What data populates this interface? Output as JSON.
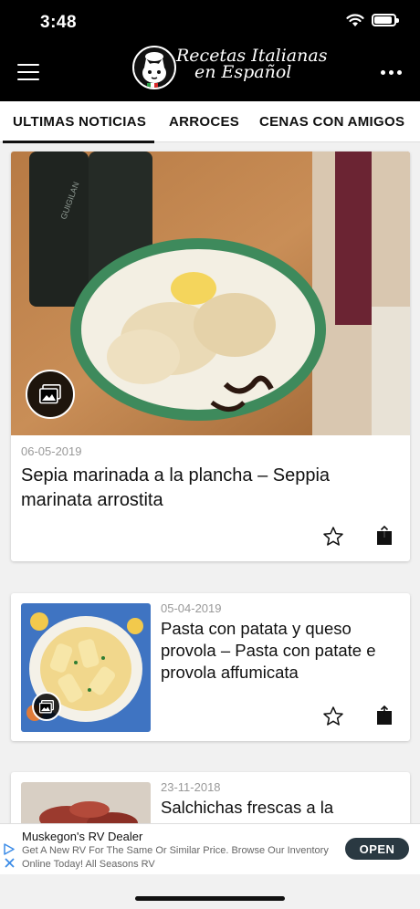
{
  "status": {
    "time": "3:48"
  },
  "header": {
    "logo_line1": "Recetas Italianas",
    "logo_line2": "en Español"
  },
  "tabs": [
    {
      "label": "ULTIMAS NOTICIAS",
      "active": true
    },
    {
      "label": "ARROCES",
      "active": false
    },
    {
      "label": "CENAS CON AMIGOS",
      "active": false
    }
  ],
  "posts": [
    {
      "date": "06-05-2019",
      "title": "Sepia marinada a la plancha – Seppia marinata arrostita"
    },
    {
      "date": "05-04-2019",
      "title": "Pasta con patata y queso provola – Pasta con patate e provola affumicata"
    },
    {
      "date": "23-11-2018",
      "title": "Salchichas frescas a la"
    }
  ],
  "ad": {
    "title": "Muskegon's RV Dealer",
    "text": "Get A New RV For The Same Or Similar Price. Browse Our Inventory Online Today! All Seasons RV",
    "cta": "OPEN"
  },
  "colors": {
    "header_bg": "#000000",
    "ad_button": "#2a3942",
    "ad_accent": "#3c8ce7"
  }
}
